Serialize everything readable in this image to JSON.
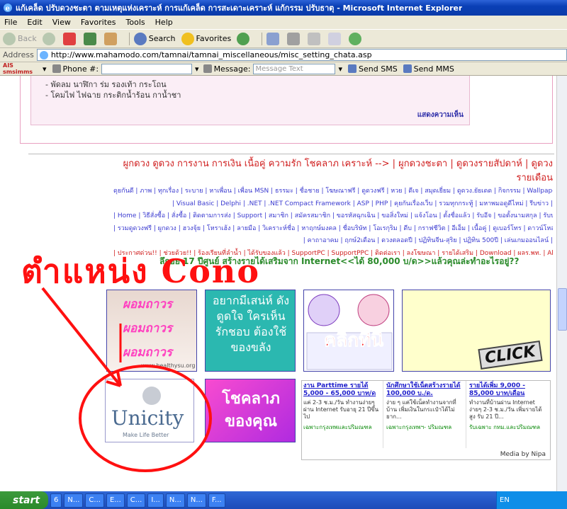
{
  "window": {
    "title": "แก้เคล็ด ปรับดวงชะตา ตามเหตุแห่งเคราะห์ การแก้เคล็ด การสะเดาะเคราะห์ แก้กรรม ปรับธาตุ - Microsoft Internet Explorer"
  },
  "menu": {
    "items": [
      "File",
      "Edit",
      "View",
      "Favorites",
      "Tools",
      "Help"
    ]
  },
  "toolbar": {
    "back": "Back",
    "search": "Search",
    "favorites": "Favorites"
  },
  "address": {
    "label": "Address",
    "url": "http://www.mahamodo.com/tamnai/tamnai_miscellaneous/misc_setting_chata.asp"
  },
  "sms": {
    "brand": "AIS smsimms",
    "phone_label": "Phone #:",
    "message_label": "Message:",
    "message_placeholder": "Message Text",
    "send_sms": "Send SMS",
    "send_mms": "Send MMS"
  },
  "content": {
    "bullet1": "- พัดลม นาฬิกา ร่ม รองเท้า กระโถน",
    "bullet2": "- โคมไฟ ไฟฉาย กระติกน้ำร้อน กาน้ำชา",
    "show_more": "แสดงความเห็น",
    "headline": "ผูกดวง ดูดวง การงาน การเงิน เนื้อคู่ ความรัก โชคลาภ เคราะห์ --> | ผูกดวงชะตา | ดูดวงรายสัปดาห์ | ดูดวงรายเดือน",
    "link_rows": [
      "ดุยกันดี | ภาพ | ทุกเรื่อง | ระบาย | หาเพื่อน | เพื่อน MSN | ธรรมะ | ชื่อชาย | โฆษณาฟรี | ดูดวงฟรี | หวย | ดีเจ | สมุดเยี่ยม | ดูดวง.ยัยเดด | กิจกรรม | Wallpaper |",
      "| Visual Basic | Delphi | .NET | .NET Compact Framework | ASP | PHP | คุยกันเรื่องเว็บ | รวมทุกกระทู้ | มหาพมอดูดีไหม่ | รีบข่าว |",
      "| Home | วิธีสั่งซื้อ | สั่งซื้อ | ติดตามการส่ง | Support | สมาชิก | สมัครสมาชิก | ขอรหัสฉุกเฉิน | ขอสิ่งใหม่ | แจ้งโอน | ตั้งชื่อแล้ว | รับอีจ | ขอตั้งนามสกุล | รับนามสกุล |",
      "| รวมดูดวงฟรี | ผูกดวง | ฮวงจุ้ย | โหราเฮ้ง | ลายมือ | วิเคราะห์ชื่อ | หาฤกษ์มงคล | ชื่อบริษัท | โอเรกุริม | ดีบ | กราฟชีวิต | อีเอ็ม | เนื้อคู่ | ดูเบอร์โทร | ดาวน์โหลดฟรี |",
      "| คาถาอาคม | ฤกษ์2เดือน | ดวงตลอดปี | ปฏิทินจีน-สุริย | ปฏิทิน 500ปี | เล่นเกมออนไลน์ |",
      "| ประกาศด่วน!! | ช่วยด้วย!! | ร้องเรียนที่ลำน้ำ | ได้รับของแล้ว | SupportPC | SupportPPC | ติดต่อเรา | ลงโฆษณา | รายได้เสริม | Download | ผลร.พท. | About |"
    ],
    "promo_line": "ลึกอย 17 ปีศูนย์ สร้างรายได้เสริมจาก Internet<<ได้ 80,000 บ/ด>>แล้วคุณล่ะทำอะไรอยู่??",
    "annotation": "ตำแหน่ง Cono"
  },
  "banners": {
    "b1_lines": [
      "ผอมถาวร",
      "ผอมถาวร",
      "ผอมถาวร"
    ],
    "b1_site": "www.healthysu.org",
    "b2_text": "อยากมีเสน่ห์ ดังดูดใจ ใครเห็น รักชอบ ต้องใช้ ของขลัง",
    "b3_text": "คลิกที่นี่",
    "b4_text": "CLICK",
    "b5_logo": "Unicity",
    "b5_slogan": "Make Life Better",
    "b6_text": "โชคลาภ ของคุณ"
  },
  "ads": [
    {
      "headline": "งาน Parttime รายได้ 5,000 - 65,000 บาท/ด",
      "body": "แค่ 2-3 ช.ม./วัน ทำงานง่ายๆ ผ่าน Internet รับอายุ 21 ปีขึ้นไป",
      "footer": "เฉพาะกรุงเทพและปริมณฑล"
    },
    {
      "headline": "นักศึกษาใช้เน็ตสร้างรายได้ 100,000 บ./ด.",
      "body": "ง่าย ๆ แค่ใช้เน็ตทำงานจากที่บ้าน เพิ่มเงินในกระเป๋าได้ไม่ยาก...",
      "footer": "เฉพาะกรุงเทพฯ- ปริมณฑล"
    },
    {
      "headline": "รายได้เพิ่ม 9,000 - 85,000 บาท/เดือน",
      "body": "ทำงานที่บ้านผ่าน Internet ง่ายๆ 2-3 ช.ม./วัน เพิ่มรายได้สูง รับ 21 ปี...",
      "footer": "รับเฉพาะ กทม.และปริมณฑล"
    }
  ],
  "media_by": "Media by Nipa",
  "taskbar": {
    "start": "start",
    "tasks": [
      "6",
      "N...",
      "C...",
      "E...",
      "C...",
      "I...",
      "N...",
      "N...",
      "F..."
    ],
    "tray": "EN"
  },
  "colors": {
    "annotation_red": "#ff1010",
    "title_blue": "#0a3fb5",
    "link_blue": "#3a3ad0"
  }
}
